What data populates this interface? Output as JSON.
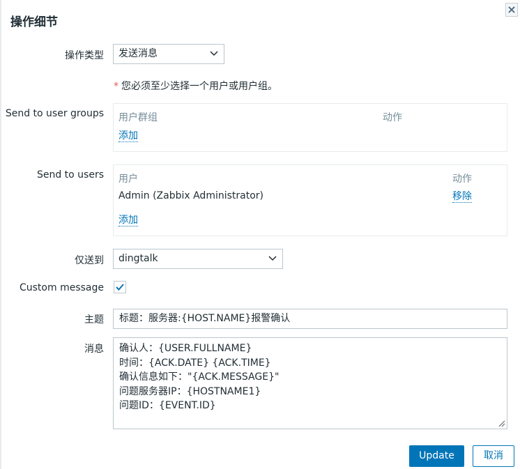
{
  "dialog": {
    "title": "操作细节",
    "close_symbol": "×"
  },
  "operation_type": {
    "label": "操作类型",
    "selected": "发送消息"
  },
  "required_note": {
    "star": "*",
    "text": "您必须至少选择一个用户或用户组。"
  },
  "user_groups": {
    "label": "Send to user groups",
    "col_group": "用户群组",
    "col_action": "动作",
    "add_label": "添加"
  },
  "users": {
    "label": "Send to users",
    "col_user": "用户",
    "col_action": "动作",
    "rows": [
      {
        "name": "Admin (Zabbix Administrator)",
        "action": "移除"
      }
    ],
    "add_label": "添加"
  },
  "send_only_to": {
    "label": "仅送到",
    "selected": "dingtalk"
  },
  "custom_message": {
    "label": "Custom message",
    "checked": true
  },
  "subject": {
    "label": "主题",
    "value": "标题：服务器:{HOST.NAME}报警确认"
  },
  "message": {
    "label": "消息",
    "lines": [
      "确认人：{USER.FULLNAME}",
      "时间：{ACK.DATE} {ACK.TIME}",
      "确认信息如下：\"{ACK.MESSAGE}\"",
      "问题服务器IP：{HOSTNAME1}",
      "问题ID：{EVENT.ID}"
    ]
  },
  "footer": {
    "update_label": "Update",
    "cancel_label": "取消"
  },
  "colors": {
    "accent": "#0275b8",
    "required": "#e45959",
    "muted": "#768d99"
  }
}
